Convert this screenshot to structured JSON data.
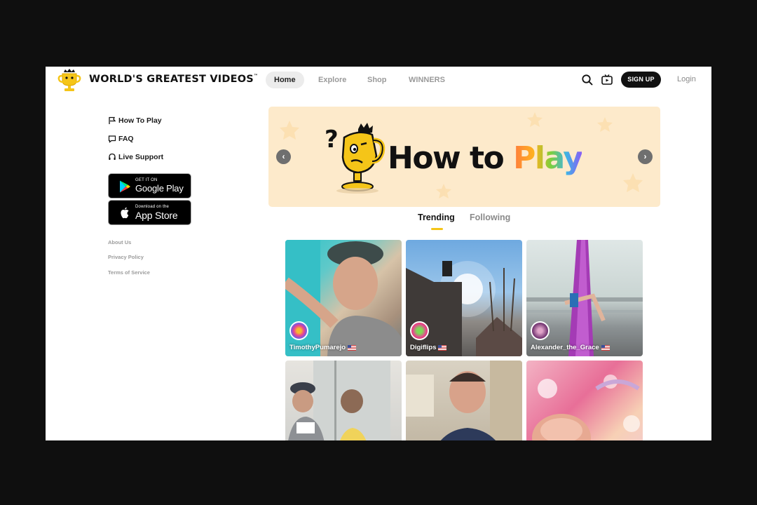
{
  "header": {
    "brand_name": "WORLD'S GREATEST VIDEOS",
    "brand_mark": "™",
    "nav": [
      {
        "label": "Home",
        "active": true
      },
      {
        "label": "Explore",
        "active": false
      },
      {
        "label": "Shop",
        "active": false
      },
      {
        "label": "WINNERS",
        "active": false
      }
    ],
    "icons": [
      "search-icon",
      "tv-icon"
    ],
    "signup_label": "SIGN UP",
    "login_label": "Login"
  },
  "sidebar": {
    "links": [
      {
        "label": "How To Play",
        "icon": "flag-icon"
      },
      {
        "label": "FAQ",
        "icon": "chat-icon"
      },
      {
        "label": "Live Support",
        "icon": "headset-icon"
      }
    ],
    "stores": [
      {
        "small": "GET IT ON",
        "big": "Google Play",
        "icon": "google-play-icon"
      },
      {
        "small": "Download on the",
        "big": "App Store",
        "icon": "apple-icon"
      }
    ],
    "footer_links": [
      "About Us",
      "Privacy Policy",
      "Terms of Service"
    ]
  },
  "banner": {
    "title_part1": "How to ",
    "title_part2": "Play",
    "prev_icon": "chevron-left-icon",
    "next_icon": "chevron-right-icon",
    "background": "#fdeacb"
  },
  "tabs": [
    {
      "label": "Trending",
      "active": true
    },
    {
      "label": "Following",
      "active": false
    }
  ],
  "videos": [
    {
      "creator": "TimothyPumarejo",
      "flag": "us-flag-icon"
    },
    {
      "creator": "Digiflips",
      "flag": "us-flag-icon"
    },
    {
      "creator": "Alexander_the_Grace",
      "flag": "us-flag-icon"
    },
    {
      "creator": ""
    },
    {
      "creator": ""
    },
    {
      "creator": ""
    }
  ],
  "colors": {
    "accent": "#f5c518",
    "text": "#111111",
    "muted": "#9a9a9a",
    "frame": "#0f0f0f"
  }
}
